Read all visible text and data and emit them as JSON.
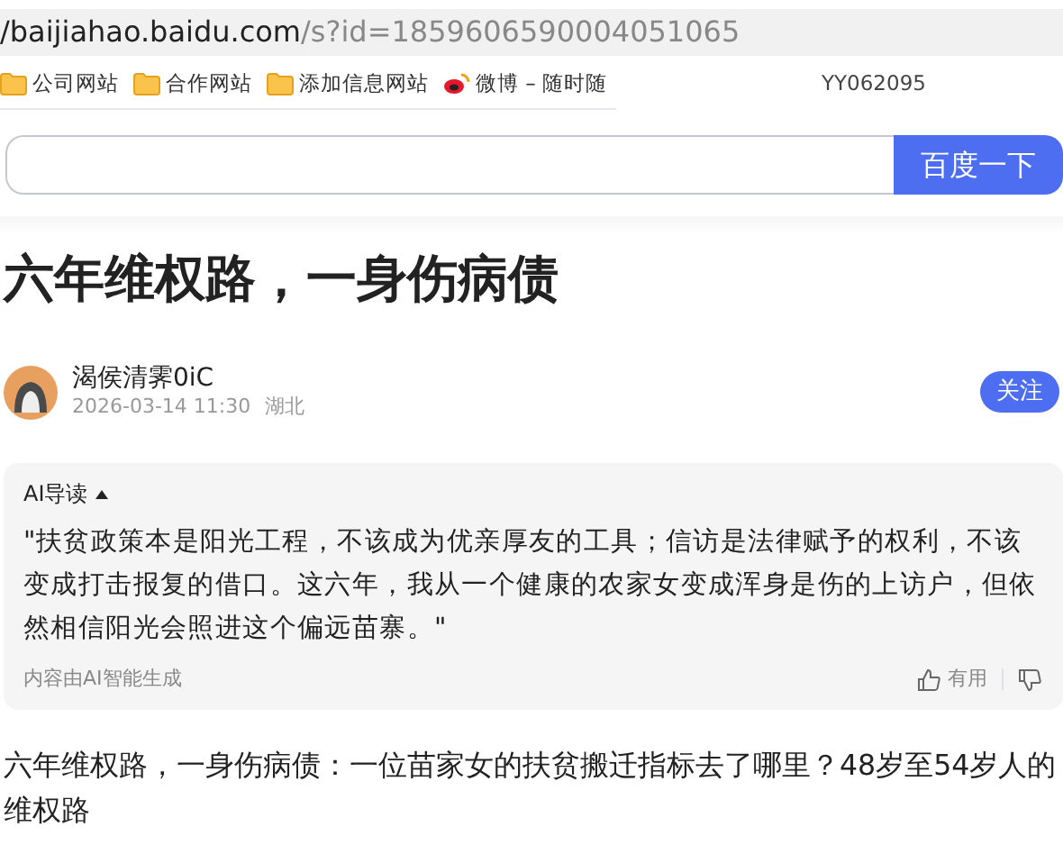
{
  "address_bar": {
    "host": "/baijiahao.baidu.com",
    "path": "/s?id=1859606590004051065"
  },
  "bookmarks": [
    {
      "kind": "folder",
      "label": "公司网站"
    },
    {
      "kind": "folder",
      "label": "合作网站"
    },
    {
      "kind": "folder",
      "label": "添加信息网站"
    },
    {
      "kind": "weibo",
      "label": "微博 – 随时随"
    },
    {
      "kind": "plain",
      "label": "YY062095"
    }
  ],
  "search": {
    "button": "百度一下"
  },
  "article": {
    "title": "六年维权路，一身伤病债",
    "author": {
      "name": "渴侯清霁0iC",
      "date": "2026-03-14 11:30",
      "location": "湖北"
    },
    "follow_button": "关注",
    "ai_summary": {
      "heading": "AI导读",
      "expanded": true,
      "quote": "\"扶贫政策本是阳光工程，不该成为优亲厚友的工具；信访是法律赋予的权利，不该变成打击报复的借口。这六年，我从一个健康的农家女变成浑身是伤的上访户，但依然相信阳光会照进这个偏远苗寨。\"",
      "footer": "内容由AI智能生成",
      "useful": "有用"
    },
    "body": "六年维权路，一身伤病债：一位苗家女的扶贫搬迁指标去了哪里？48岁至54岁人的维权路"
  }
}
